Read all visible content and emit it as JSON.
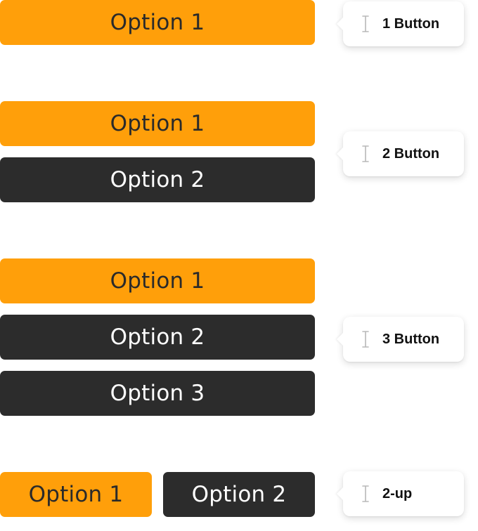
{
  "colors": {
    "primary": "#FF9F0A",
    "secondary": "#2C2C2C",
    "primary_text": "#2A2A2A",
    "secondary_text": "#FFFFFF"
  },
  "groups": [
    {
      "label": "1 Button",
      "icon": "text-cursor-icon",
      "buttons": [
        "Option 1"
      ]
    },
    {
      "label": "2 Button",
      "icon": "text-cursor-icon",
      "buttons": [
        "Option 1",
        "Option 2"
      ]
    },
    {
      "label": "3 Button",
      "icon": "text-cursor-icon",
      "buttons": [
        "Option 1",
        "Option 2",
        "Option 3"
      ]
    },
    {
      "label": "2-up",
      "icon": "text-cursor-icon",
      "buttons": [
        "Option 1",
        "Option 2"
      ]
    }
  ]
}
